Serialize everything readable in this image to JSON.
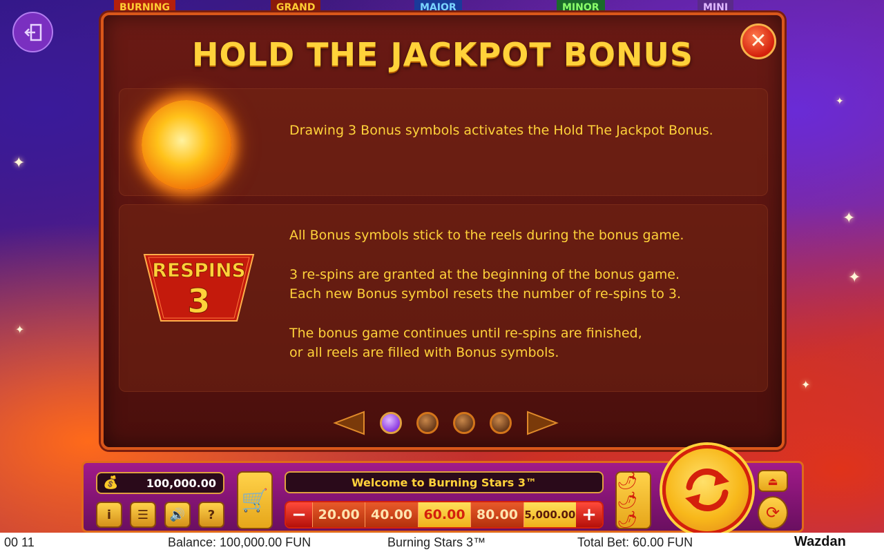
{
  "jackpot_tags": [
    "BURNING",
    "GRAND",
    "MAJOR",
    "MINOR",
    "MINI"
  ],
  "panel": {
    "title": "HOLD THE JACKPOT BONUS",
    "close_label": "✕",
    "section1": {
      "icon": "fireball-sun-icon",
      "text": "Drawing 3 Bonus symbols activates the Hold The Jackpot Bonus."
    },
    "section2": {
      "badge_label": "RESPINS",
      "badge_value": "3",
      "paragraph1": "All Bonus symbols stick to the reels during the bonus game.",
      "paragraph2_line1": "3 re-spins are granted at the beginning of the bonus game.",
      "paragraph2_line2": "Each new Bonus symbol resets the number of re-spins to 3.",
      "paragraph3_line1": "The bonus game continues until re-spins are finished,",
      "paragraph3_line2": "or all reels are filled with Bonus symbols."
    },
    "pager": {
      "page_count": 4,
      "current_page": 1
    }
  },
  "controls": {
    "balance": "100,000.00",
    "message": "Welcome to Burning Stars 3™",
    "bet_options": [
      "20.00",
      "40.00",
      "60.00",
      "80.00",
      "5,000.00"
    ],
    "selected_bet": "60.00",
    "minus_label": "−",
    "plus_label": "+",
    "info_label": "i",
    "help_label": "?"
  },
  "status_bar": {
    "time": "00 11",
    "balance": "Balance: 100,000.00 FUN",
    "game": "Burning Stars 3™",
    "total_bet": "Total Bet: 60.00 FUN",
    "logo": "Wazdan"
  },
  "colors": {
    "title_gold": "#ffd23a",
    "panel_bg": "#5a1410",
    "panel_border": "#d9571a",
    "active_dot": "#8a3ae0"
  }
}
